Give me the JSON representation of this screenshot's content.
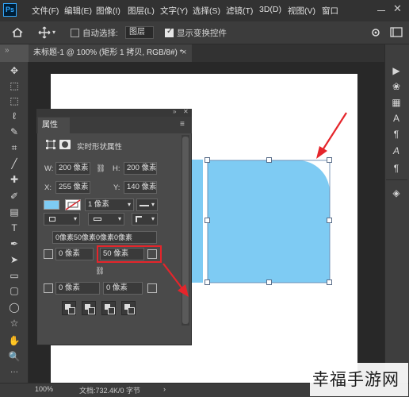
{
  "menubar": {
    "logo": "Ps",
    "items": [
      "文件(F)",
      "编辑(E)",
      "图像(I)",
      "图层(L)",
      "文字(Y)",
      "选择(S)",
      "滤镜(T)",
      "3D(D)",
      "视图(V)",
      "窗口"
    ],
    "close_label": "✕"
  },
  "options": {
    "auto_select_label": "自动选择:",
    "auto_select_value": "图层",
    "show_transform_label": "显示变换控件"
  },
  "document": {
    "tab_title": "未标题-1 @ 100% (矩形 1 拷贝, RGB/8#) *",
    "close": "×"
  },
  "properties": {
    "tab": "属性",
    "header": "实时形状属性",
    "w_label": "W:",
    "w_value": "200 像素",
    "h_label": "H:",
    "h_value": "200 像素",
    "x_label": "X:",
    "x_value": "255 像素",
    "y_label": "Y:",
    "y_value": "140 像素",
    "stroke_width": "1 像素",
    "corner_all": "0像素50像素0像素0像素",
    "corner_tl": "0 像素",
    "corner_tr": "50 像素",
    "corner_bl": "0 像素",
    "corner_br": "0 像素"
  },
  "status": {
    "zoom": "100%",
    "doc_info": "文档:732.4K/0 字节"
  },
  "watermark": "幸福手游网",
  "colors": {
    "shape_fill": "#7ecbf3",
    "highlight": "#e5252b",
    "canvas_bg": "#ffffff"
  },
  "icons": {
    "left_tools": [
      "move-icon",
      "artboard-icon",
      "marquee-icon",
      "lasso-icon",
      "quick-select-icon",
      "crop-icon",
      "eyedropper-icon",
      "healing-icon",
      "brush-icon",
      "clone-icon",
      "eraser-icon",
      "gradient-icon",
      "blur-icon",
      "text-icon",
      "pen-icon",
      "path-select-icon",
      "rectangle-icon",
      "zoom-icon",
      "hand-icon"
    ],
    "right_tools": [
      "history-icon",
      "brushes-icon",
      "swatches-icon",
      "character-icon",
      "paragraph-icon",
      "glyphs-icon",
      "paragraph-styles-icon",
      "layers-icon"
    ]
  }
}
